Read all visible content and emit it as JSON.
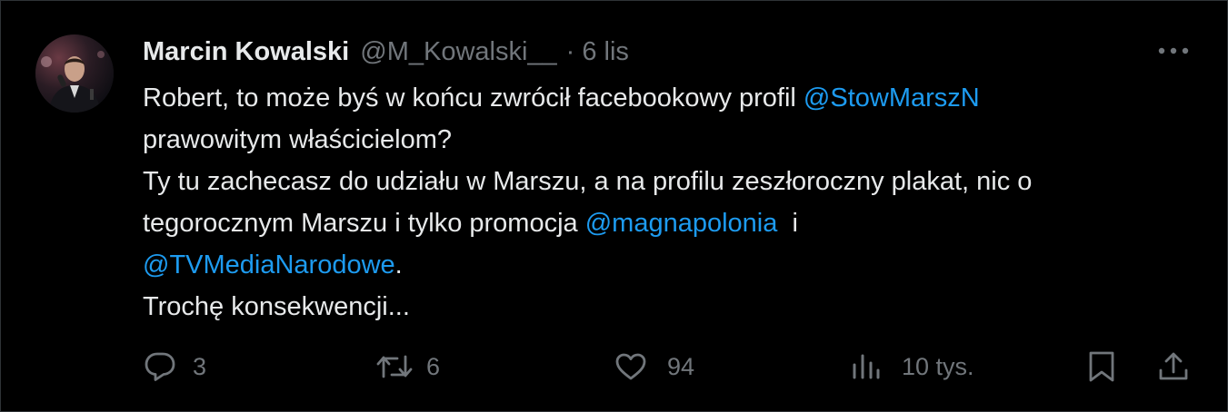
{
  "tweet": {
    "author_name": "Marcin Kowalski",
    "handle": "@M_Kowalski__",
    "separator": "·",
    "time": "6 lis",
    "more_icon": "more-dots-icon",
    "text": {
      "line1_a": "Robert, to może byś w końcu zwrócił facebookowy profil ",
      "mention1": "@StowMarszN",
      "line2": "prawowitym właścicielom?",
      "line3": "Ty tu zachecasz do udziału w Marszu, a na profilu zeszłoroczny plakat, nic o",
      "line4_a": "tegorocznym Marszu i tylko promocja ",
      "mention2": "@magnapolonia",
      "line4_b": "  i",
      "mention3": "@TVMediaNarodowe",
      "line5_b": ".",
      "line6": "Trochę konsekwencji..."
    }
  },
  "actions": {
    "reply": {
      "icon": "reply-icon",
      "count": "3"
    },
    "retweet": {
      "icon": "retweet-icon",
      "count": "6"
    },
    "like": {
      "icon": "heart-icon",
      "count": "94"
    },
    "views": {
      "icon": "views-chart-icon",
      "count": "10 tys."
    },
    "bookmark": {
      "icon": "bookmark-icon"
    },
    "share": {
      "icon": "share-icon"
    }
  },
  "colors": {
    "background": "#000000",
    "text": "#e7e9ea",
    "muted": "#71767b",
    "link": "#1d9bf0",
    "border": "#2f3336"
  }
}
